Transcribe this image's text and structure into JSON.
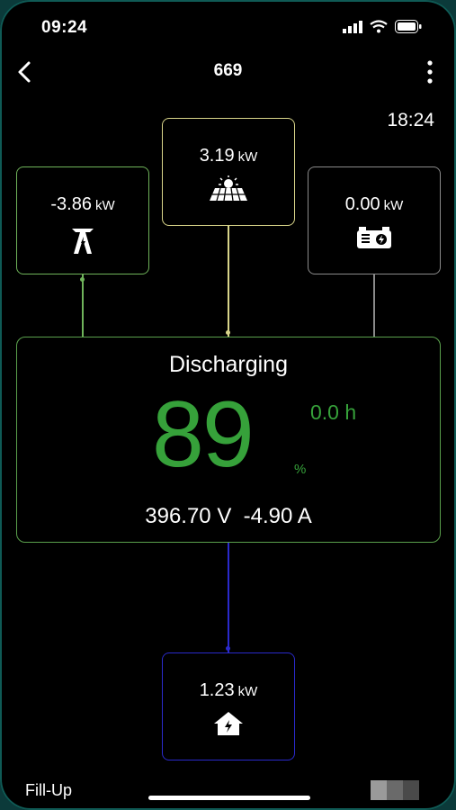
{
  "status_bar": {
    "time": "09:24"
  },
  "header": {
    "title": "669"
  },
  "clock": "18:24",
  "grid": {
    "value": "-3.86",
    "unit": "kW"
  },
  "solar": {
    "value": "3.19",
    "unit": "kW"
  },
  "generator": {
    "value": "0.00",
    "unit": "kW"
  },
  "home": {
    "value": "1.23",
    "unit": "kW"
  },
  "battery": {
    "state": "Discharging",
    "soc": "89",
    "soc_unit": "%",
    "remaining": "0.0 h",
    "voltage_current": "396.70 V  -4.90 A"
  },
  "footer": {
    "fill_up": "Fill-Up"
  },
  "icons": {
    "back": "chevron-left-icon",
    "more": "more-vertical-icon",
    "grid": "power-tower-icon",
    "solar": "solar-panel-icon",
    "generator": "generator-icon",
    "home": "house-icon"
  },
  "colors": {
    "grid": "#6fb35a",
    "solar": "#d9d58a",
    "generator": "#8a8a8a",
    "home": "#2a2acc",
    "battery_border": "#5aa04c",
    "soc_text": "#36a13a"
  }
}
